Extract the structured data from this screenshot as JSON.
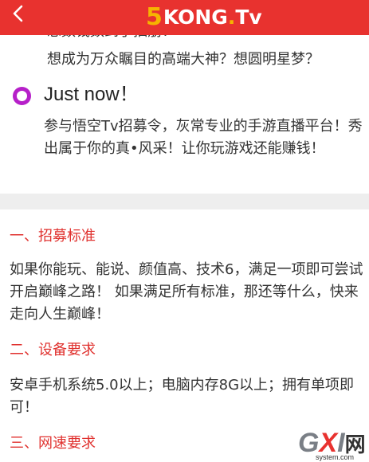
{
  "header": {
    "back_icon": "chevron-left-icon",
    "logo": {
      "number": "5",
      "kong": "KONG",
      "dot": ".",
      "tv": "Tv"
    },
    "colors": {
      "bar": "#e8322f",
      "accent": "#f6b400"
    }
  },
  "intro": {
    "cut_line": "想数钱数到手抽筋！",
    "line": "想成为万众瞩目的高端大神？想圆明星梦？"
  },
  "just_now": {
    "icon": "ring-icon",
    "title": "Just now！",
    "text": "参与悟空Tv招募令，灰常专业的手游直播平台！秀出属于你的真•风采！让你玩游戏还能赚钱！"
  },
  "sections": [
    {
      "title": "一、招募标准",
      "text": "如果你能玩、能说、颜值高、技术6，满足一项即可尝试开启巅峰之路！ 如果满足所有标准，那还等什么，快来走向人生巅峰！"
    },
    {
      "title": "二、设备要求",
      "text": "安卓手机系统5.0以上；电脑内存8G以上；拥有单项即可！"
    },
    {
      "title": "三、网速要求",
      "text": ""
    }
  ],
  "watermark": {
    "g": "G",
    "x": "X",
    "i": "I",
    "wang": "网",
    "url": "system.com"
  }
}
